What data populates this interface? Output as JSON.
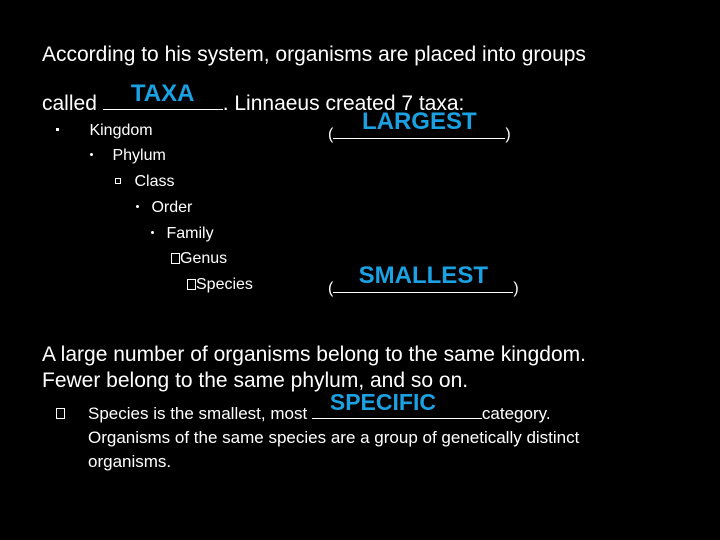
{
  "slide": {
    "intro_line1": "According to his system, organisms are placed into groups",
    "intro_line2_prefix": "called ",
    "intro_blank_answer": "TAXA",
    "intro_line2_suffix": ".  Linnaeus created 7 taxa:",
    "hierarchy": [
      {
        "label": "Kingdom",
        "bullet": "square-dot"
      },
      {
        "label": "Phylum",
        "bullet": "dot"
      },
      {
        "label": "Class",
        "bullet": "hollow-square"
      },
      {
        "label": "Order",
        "bullet": "dot"
      },
      {
        "label": "Family",
        "bullet": "dot"
      },
      {
        "label": "Genus",
        "bullet": "box"
      },
      {
        "label": "Species",
        "bullet": "box"
      }
    ],
    "largest_answer": "LARGEST",
    "smallest_answer": "SMALLEST",
    "paren_open": "(",
    "paren_close": ")",
    "para_line1": "A large number of organisms belong to the same kingdom.",
    "para_line2": "Fewer belong to the same phylum, and so on.",
    "bullet_line1_prefix": "Species is the smallest, most ",
    "specific_answer": "SPECIFIC",
    "bullet_line1_suffix": "category.",
    "bullet_line2": "Organisms of the same species are a group of genetically distinct",
    "bullet_line3": "organisms.",
    "accent_color": "#1BA1E2"
  }
}
